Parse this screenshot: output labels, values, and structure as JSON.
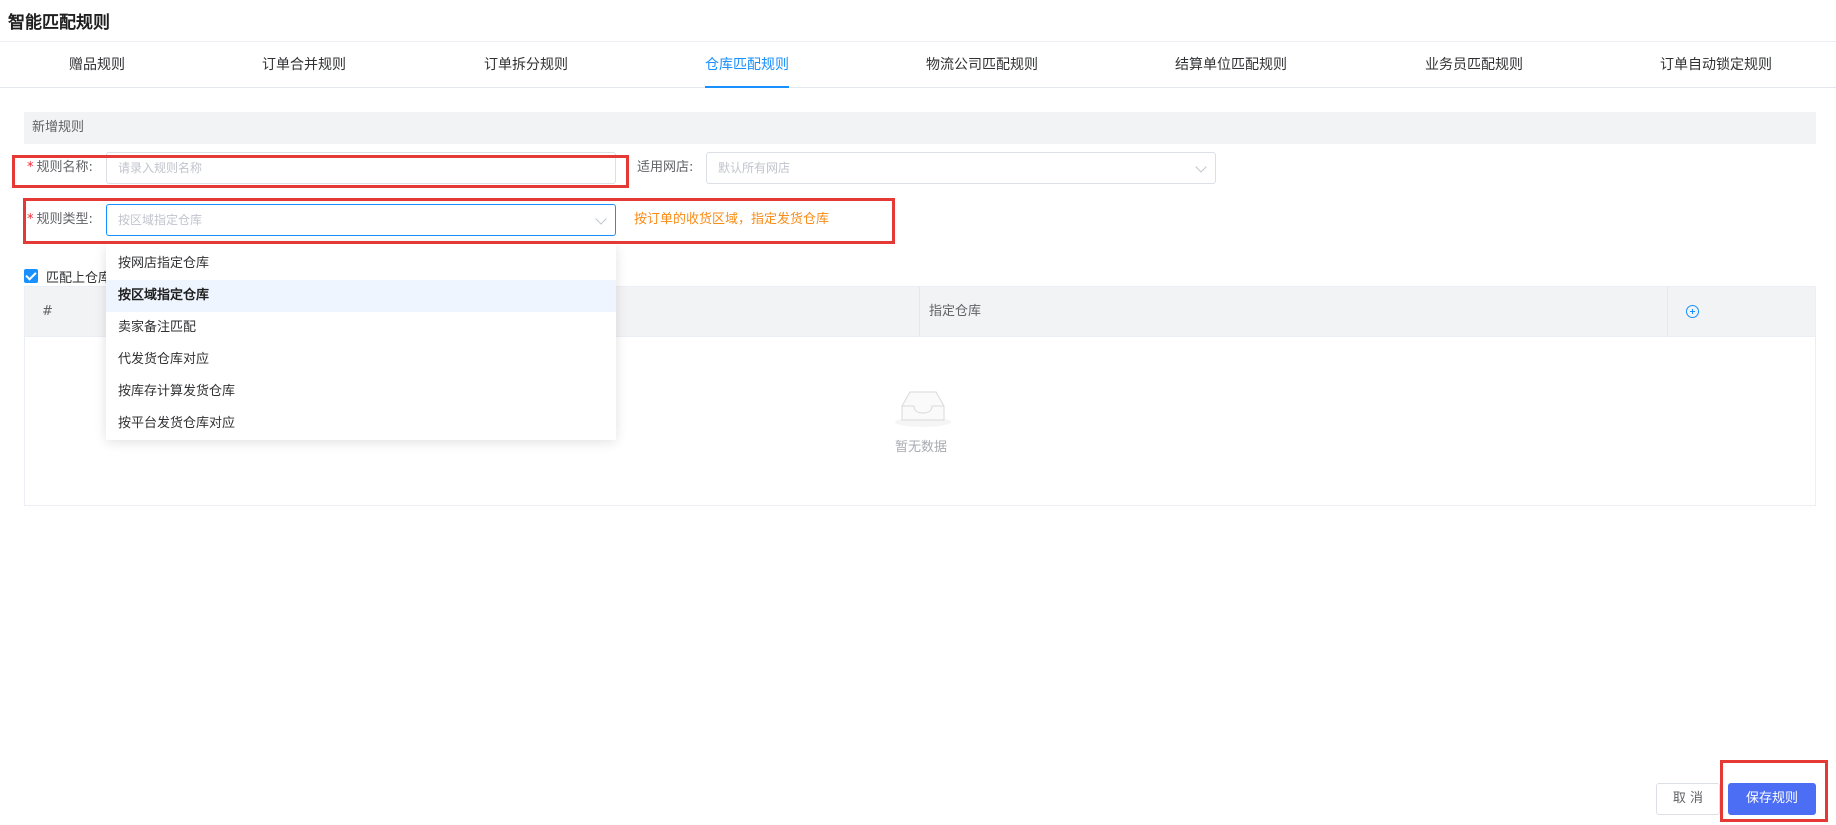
{
  "page": {
    "title": "智能匹配规则"
  },
  "tabs": [
    {
      "label": "赠品规则",
      "active": false
    },
    {
      "label": "订单合并规则",
      "active": false
    },
    {
      "label": "订单拆分规则",
      "active": false
    },
    {
      "label": "仓库匹配规则",
      "active": true
    },
    {
      "label": "物流公司匹配规则",
      "active": false
    },
    {
      "label": "结算单位匹配规则",
      "active": false
    },
    {
      "label": "业务员匹配规则",
      "active": false
    },
    {
      "label": "订单自动锁定规则",
      "active": false
    }
  ],
  "section": {
    "title": "新增规则"
  },
  "form": {
    "required_mark": "*",
    "rule_name": {
      "label": "规则名称:",
      "placeholder": "请录入规则名称",
      "value": ""
    },
    "shop": {
      "label": "适用网店:",
      "placeholder": "默认所有网店"
    },
    "rule_type": {
      "label": "规则类型:",
      "value": "按区域指定仓库",
      "hint": "按订单的收货区域，指定发货仓库",
      "options": [
        {
          "label": "按网店指定仓库",
          "selected": false
        },
        {
          "label": "按区域指定仓库",
          "selected": true
        },
        {
          "label": "卖家备注匹配",
          "selected": false
        },
        {
          "label": "代发货仓库对应",
          "selected": false
        },
        {
          "label": "按库存计算发货仓库",
          "selected": false
        },
        {
          "label": "按平台发货仓库对应",
          "selected": false
        }
      ]
    },
    "match_checkbox": {
      "label": "匹配上仓库",
      "checked": true
    }
  },
  "table": {
    "columns": [
      "#",
      "指定仓库"
    ],
    "empty_text": "暂无数据"
  },
  "buttons": {
    "cancel": "取 消",
    "save": "保存规则"
  },
  "colors": {
    "accent": "#1890ff",
    "primary_button": "#4c6ef5",
    "required": "#f5222d",
    "hint": "#fa8c16",
    "annotation_box": "#e53935"
  },
  "icons": [
    "chevron-down-icon",
    "check-icon",
    "add-circle-icon",
    "empty-inbox-icon"
  ]
}
